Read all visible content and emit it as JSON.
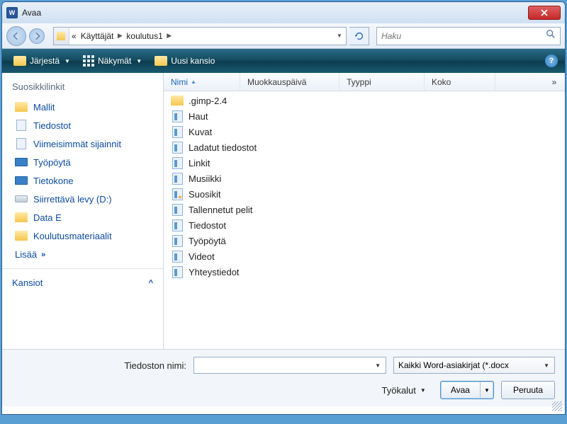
{
  "window": {
    "title": "Avaa"
  },
  "breadcrumb": {
    "root_symbol": "«",
    "segments": [
      "Käyttäjät",
      "koulutus1"
    ]
  },
  "search": {
    "placeholder": "Haku"
  },
  "toolbar": {
    "organize": "Järjestä",
    "views": "Näkymät",
    "new_folder": "Uusi kansio"
  },
  "sidebar": {
    "header": "Suosikkilinkit",
    "items": [
      {
        "label": "Mallit",
        "icon": "folder"
      },
      {
        "label": "Tiedostot",
        "icon": "doc"
      },
      {
        "label": "Viimeisimmät sijainnit",
        "icon": "doc"
      },
      {
        "label": "Työpöytä",
        "icon": "mon"
      },
      {
        "label": "Tietokone",
        "icon": "mon"
      },
      {
        "label": "Siirrettävä levy (D:)",
        "icon": "drive"
      },
      {
        "label": "Data E",
        "icon": "folder"
      },
      {
        "label": "Koulutusmateriaalit",
        "icon": "folder"
      }
    ],
    "more": "Lisää",
    "folders": "Kansiot"
  },
  "columns": {
    "c0": "Nimi",
    "c1": "Muokkauspäivä",
    "c2": "Tyyppi",
    "c3": "Koko",
    "more": "»"
  },
  "files": [
    {
      "name": ".gimp-2.4",
      "icon": "folder"
    },
    {
      "name": "Haut",
      "icon": "sp"
    },
    {
      "name": "Kuvat",
      "icon": "sp"
    },
    {
      "name": "Ladatut tiedostot",
      "icon": "sp"
    },
    {
      "name": "Linkit",
      "icon": "sp"
    },
    {
      "name": "Musiikki",
      "icon": "sp"
    },
    {
      "name": "Suosikit",
      "icon": "star"
    },
    {
      "name": "Tallennetut pelit",
      "icon": "sp"
    },
    {
      "name": "Tiedostot",
      "icon": "sp"
    },
    {
      "name": "Työpöytä",
      "icon": "sp"
    },
    {
      "name": "Videot",
      "icon": "sp"
    },
    {
      "name": "Yhteystiedot",
      "icon": "sp"
    }
  ],
  "bottom": {
    "filename_label": "Tiedoston nimi:",
    "filter": "Kaikki Word-asiakirjat (*.docx",
    "tools": "Työkalut",
    "open": "Avaa",
    "cancel": "Peruuta"
  }
}
